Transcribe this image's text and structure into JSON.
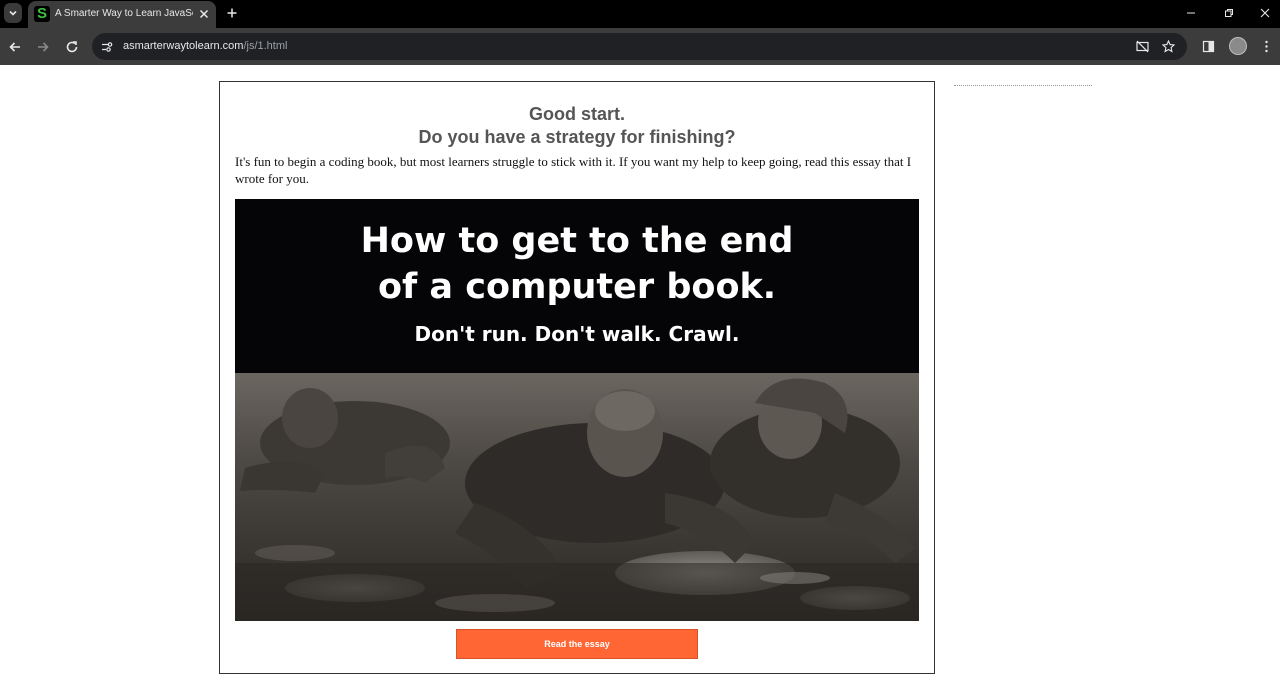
{
  "browser": {
    "tab": {
      "title": "A Smarter Way to Learn JavaScript",
      "favicon_letter": "S"
    },
    "address": {
      "host": "asmarterwaytolearn.com",
      "path": "/js/1.html"
    },
    "icons": [
      "tab-search-icon",
      "close-icon",
      "plus-icon",
      "minimize-icon",
      "restore-icon",
      "back-icon",
      "forward-icon",
      "reload-icon",
      "site-info-icon",
      "screen-cast-off-icon",
      "bookmark-star-icon",
      "side-panel-icon",
      "avatar",
      "menu-dots-icon"
    ]
  },
  "promo": {
    "heading_line1": "Good start.",
    "heading_line2": "Do you have a strategy for finishing?",
    "intro": "It's fun to begin a coding book, but most learners struggle to stick with it. If you want my help to keep going, read this essay that I wrote for you.",
    "image": {
      "title_line1": "How to get to the end",
      "title_line2": "of a computer book.",
      "subtitle": "Don't run. Don't walk. Crawl."
    },
    "button_label": "Read the essay"
  },
  "colors": {
    "button": "#ff6633",
    "heading": "#555555",
    "tabbar": "#000000",
    "toolbar": "#3c3c3c"
  }
}
